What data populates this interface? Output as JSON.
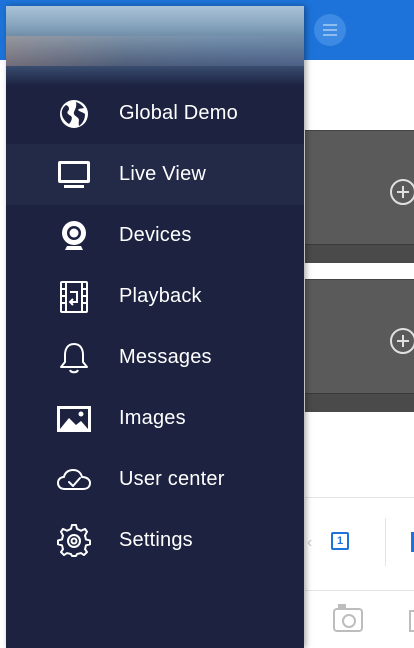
{
  "drawer": {
    "items": [
      {
        "id": "global-demo",
        "label": "Global Demo",
        "icon": "globe-icon",
        "active": false
      },
      {
        "id": "live-view",
        "label": "Live View",
        "icon": "monitor-icon",
        "active": true
      },
      {
        "id": "devices",
        "label": "Devices",
        "icon": "webcam-icon",
        "active": false
      },
      {
        "id": "playback",
        "label": "Playback",
        "icon": "film-playback-icon",
        "active": false
      },
      {
        "id": "messages",
        "label": "Messages",
        "icon": "bell-icon",
        "active": false
      },
      {
        "id": "images",
        "label": "Images",
        "icon": "image-icon",
        "active": false
      },
      {
        "id": "user-center",
        "label": "User center",
        "icon": "cloud-check-icon",
        "active": false
      },
      {
        "id": "settings",
        "label": "Settings",
        "icon": "gear-icon",
        "active": false
      }
    ]
  },
  "background": {
    "split_label": "1",
    "accent_color": "#1d73d9"
  }
}
